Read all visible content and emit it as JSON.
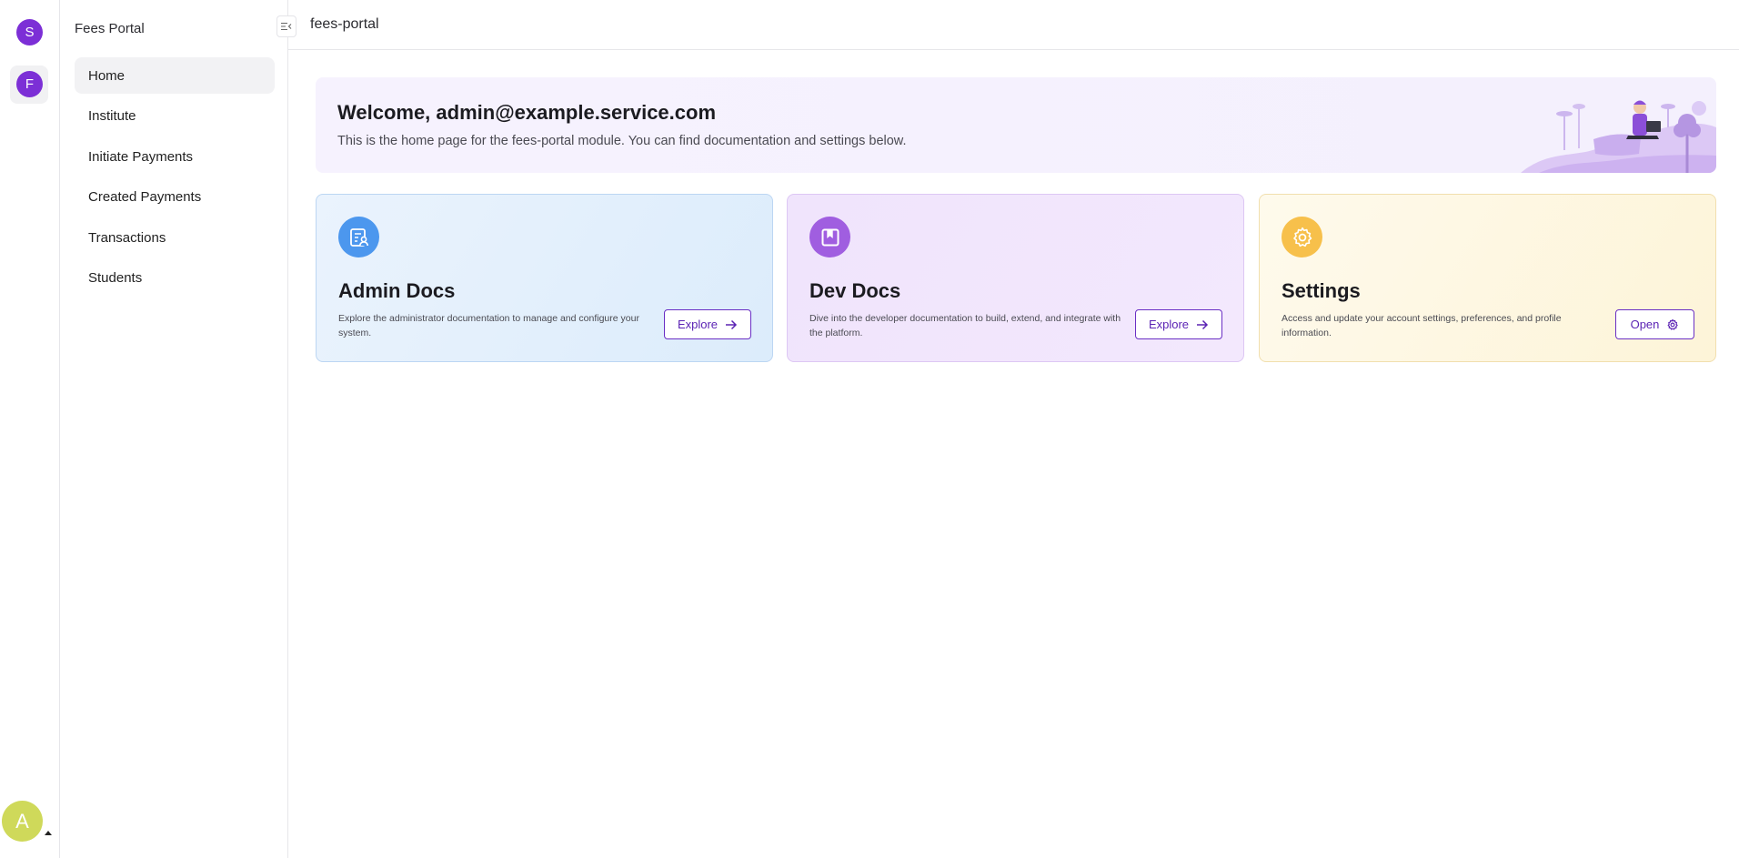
{
  "rail": {
    "workspaces": [
      {
        "letter": "S"
      },
      {
        "letter": "F"
      }
    ],
    "user_initial": "A"
  },
  "sidebar": {
    "title": "Fees Portal",
    "items": [
      {
        "label": "Home",
        "active": true
      },
      {
        "label": "Institute"
      },
      {
        "label": "Initiate Payments"
      },
      {
        "label": "Created Payments"
      },
      {
        "label": "Transactions"
      },
      {
        "label": "Students"
      }
    ]
  },
  "header": {
    "title": "fees-portal"
  },
  "welcome": {
    "title": "Welcome, admin@example.service.com",
    "subtitle": "This is the home page for the fees-portal module. You can find documentation and settings below."
  },
  "cards": [
    {
      "title": "Admin Docs",
      "description": "Explore the administrator documentation to manage and configure your system.",
      "button_label": "Explore",
      "icon": "admin-docs-icon",
      "accent": "#4c97ee"
    },
    {
      "title": "Dev Docs",
      "description": "Dive into the developer documentation to build, extend, and integrate with the platform.",
      "button_label": "Explore",
      "icon": "dev-docs-icon",
      "accent": "#a05ee0"
    },
    {
      "title": "Settings",
      "description": "Access and update your account settings, preferences, and profile information.",
      "button_label": "Open",
      "icon": "gear-icon",
      "accent": "#f7c04b"
    }
  ],
  "colors": {
    "brand": "#7c2fd6",
    "button_border": "#6a2fc4"
  }
}
